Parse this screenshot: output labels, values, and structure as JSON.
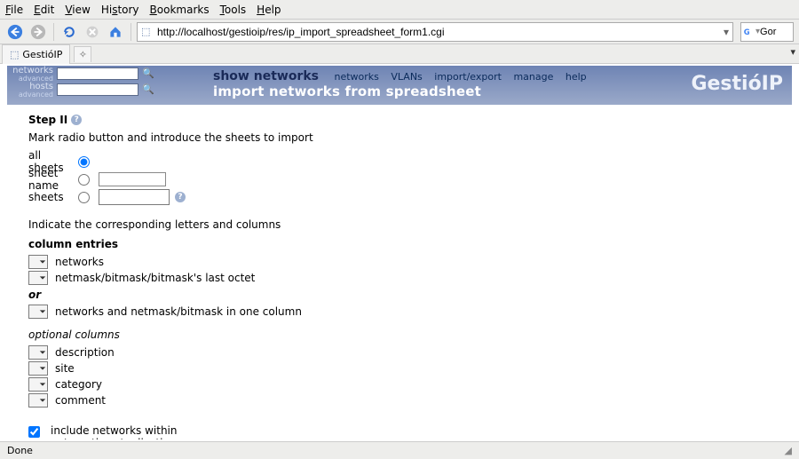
{
  "menubar": {
    "file": "File",
    "edit": "Edit",
    "view": "View",
    "history": "History",
    "bookmarks": "Bookmarks",
    "tools": "Tools",
    "help": "Help"
  },
  "url": "http://localhost/gestioip/res/ip_import_spreadsheet_form1.cgi",
  "search_placeholder": "Gor",
  "tab": {
    "title": "GestióIP"
  },
  "leftpanel": {
    "networks": "networks",
    "hosts": "hosts",
    "advanced": "advanced"
  },
  "nav": {
    "show": "show networks",
    "networks": "networks",
    "vlans": "VLANs",
    "importexport": "import/export",
    "manage": "manage",
    "help": "help"
  },
  "subtitle": "import networks from spreadsheet",
  "brand": "GestióIP",
  "step": "Step II",
  "instr": "Mark radio button and introduce the sheets to import",
  "radios": {
    "all": "all sheets",
    "name": "sheet name",
    "sheets": "sheets"
  },
  "colsection": "Indicate the corresponding letters and columns",
  "colentries": "column entries",
  "rows": {
    "networks": "networks",
    "netmask": "netmask/bitmask/bitmask's last octet",
    "or": "or",
    "netcombined": "networks and netmask/bitmask in one column"
  },
  "optcols": "optional columns",
  "opt": {
    "description": "description",
    "site": "site",
    "category": "category",
    "comment": "comment"
  },
  "include": "include networks within\nautomatic actualization",
  "status": "Done"
}
